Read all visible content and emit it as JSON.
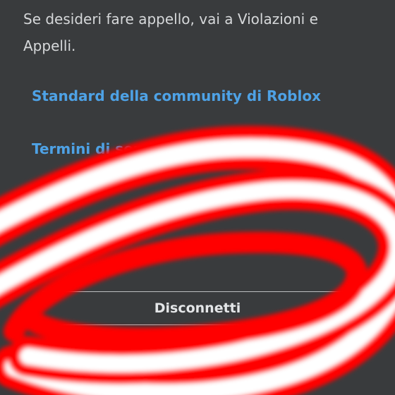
{
  "notice": {
    "text": "Se desideri fare appello, vai a Violazioni e Appelli."
  },
  "links": {
    "standards": "Standard della community di Roblox",
    "terms": "Termini di servizio"
  },
  "actions": {
    "logout_label": "Disconnetti"
  },
  "overlay": {
    "red": "#ff0000",
    "white": "#ffffff"
  }
}
